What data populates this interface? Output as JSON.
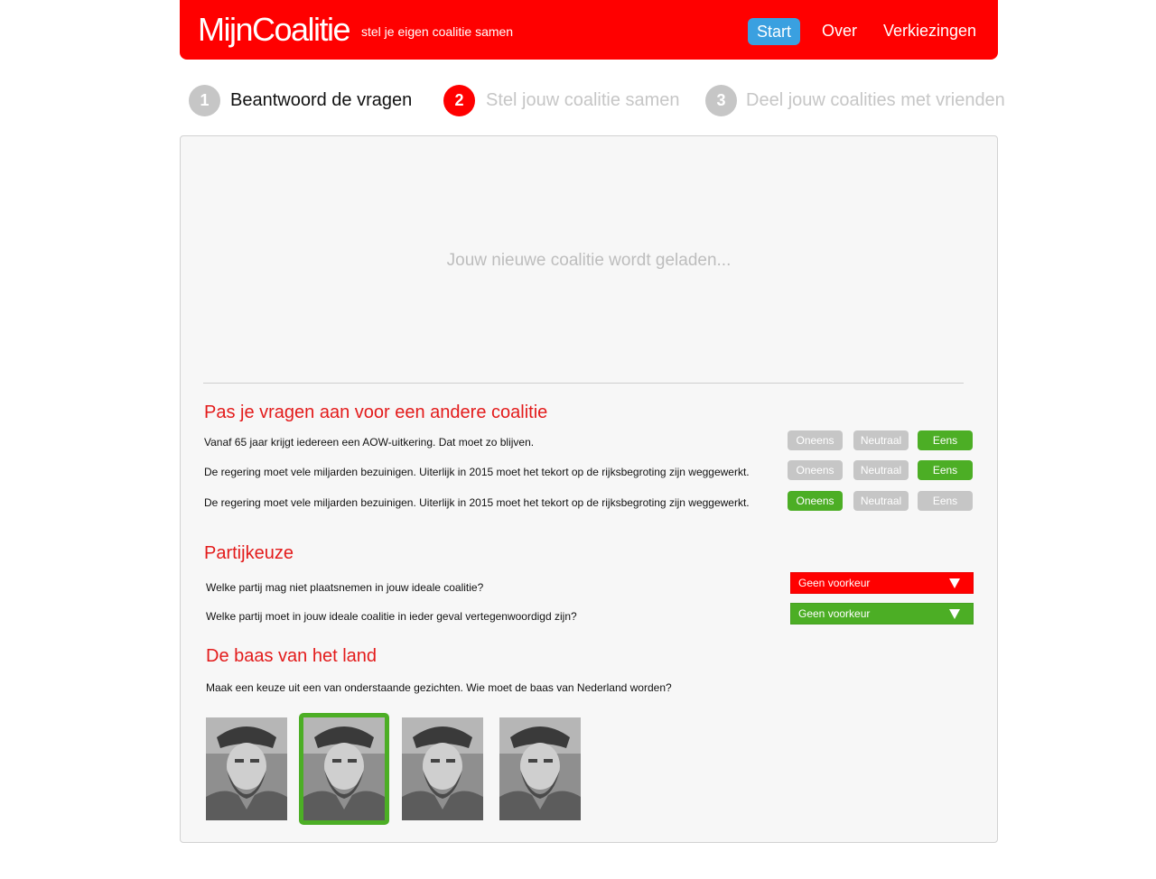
{
  "header": {
    "logo": "MijnCoalitie",
    "tagline": "stel je eigen coalitie samen",
    "nav": [
      "Start",
      "Over",
      "Verkiezingen"
    ]
  },
  "steps": [
    {
      "number": "1",
      "label": "Beantwoord de vragen"
    },
    {
      "number": "2",
      "label": "Stel jouw coalitie samen"
    },
    {
      "number": "3",
      "label": "Deel jouw coalities met vrienden"
    }
  ],
  "loading_text": "Jouw nieuwe coalitie wordt geladen...",
  "questions_section": {
    "title": "Pas je vragen aan voor een andere coalitie",
    "options": [
      "Oneens",
      "Neutraal",
      "Eens"
    ],
    "questions": [
      {
        "text": "Vanaf 65 jaar krijgt iedereen een AOW-uitkering. Dat moet zo blijven.",
        "selected": "Eens"
      },
      {
        "text": "De regering moet vele miljarden bezuinigen. Uiterlijk in 2015 moet het tekort op de rijksbegroting zijn weggewerkt.",
        "selected": "Eens"
      },
      {
        "text": "De regering moet vele miljarden bezuinigen. Uiterlijk in 2015 moet het tekort op de rijksbegroting zijn weggewerkt.",
        "selected": "Oneens"
      }
    ]
  },
  "party_section": {
    "title": "Partijkeuze",
    "q1": "Welke partij mag niet plaatsnemen in jouw ideale coalitie?",
    "q1_value": "Geen voorkeur",
    "q2": "Welke partij moet in jouw ideale coalitie in ieder geval vertegenwoordigd zijn?",
    "q2_value": "Geen voorkeur"
  },
  "boss_section": {
    "title": "De baas van het land",
    "prompt": "Maak een keuze uit een van onderstaande gezichten. Wie moet de baas van Nederland worden?",
    "selected_index": 1
  },
  "colors": {
    "brand_red": "#ff0000",
    "active_blue": "#3aa0e0",
    "agree_green": "#4cae25",
    "inactive_grey": "#c6c6c6",
    "title_red": "#e31b1b"
  }
}
